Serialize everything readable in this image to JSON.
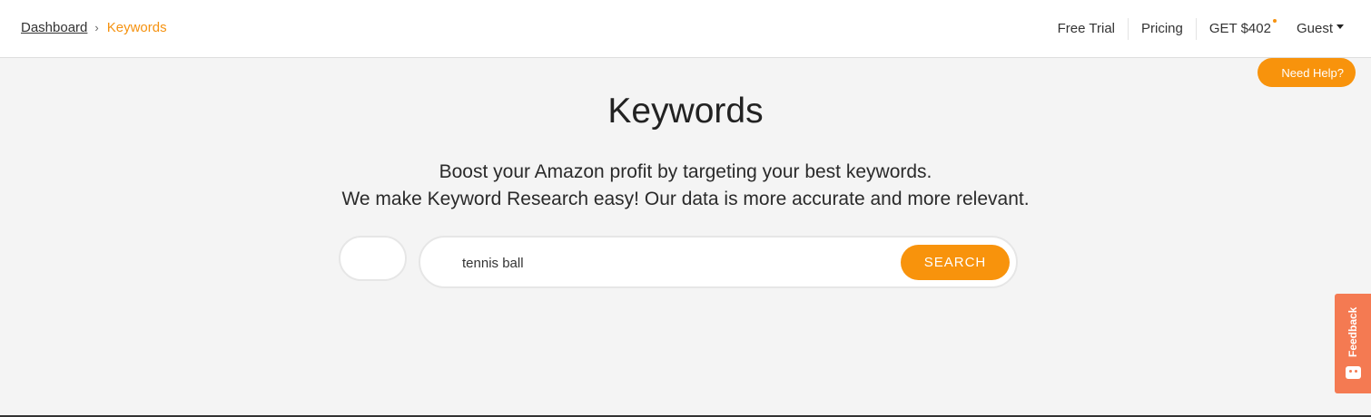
{
  "breadcrumb": {
    "items": [
      {
        "label": "Dashboard"
      },
      {
        "label": "Keywords"
      }
    ],
    "separator": "›"
  },
  "nav": {
    "free_trial": "Free Trial",
    "pricing": "Pricing",
    "get_offer": "GET $402",
    "guest": "Guest"
  },
  "help": {
    "label": "Need Help?"
  },
  "main": {
    "title": "Keywords",
    "subtitle_line1": "Boost your Amazon profit by targeting your best keywords.",
    "subtitle_line2": "We make Keyword Research easy! Our data is more accurate and more relevant."
  },
  "search": {
    "value": "tennis ball",
    "button_label": "SEARCH"
  },
  "feedback": {
    "label": "Feedback"
  },
  "colors": {
    "accent": "#f8930c",
    "feedback": "#f47a52",
    "background": "#f4f4f4"
  }
}
